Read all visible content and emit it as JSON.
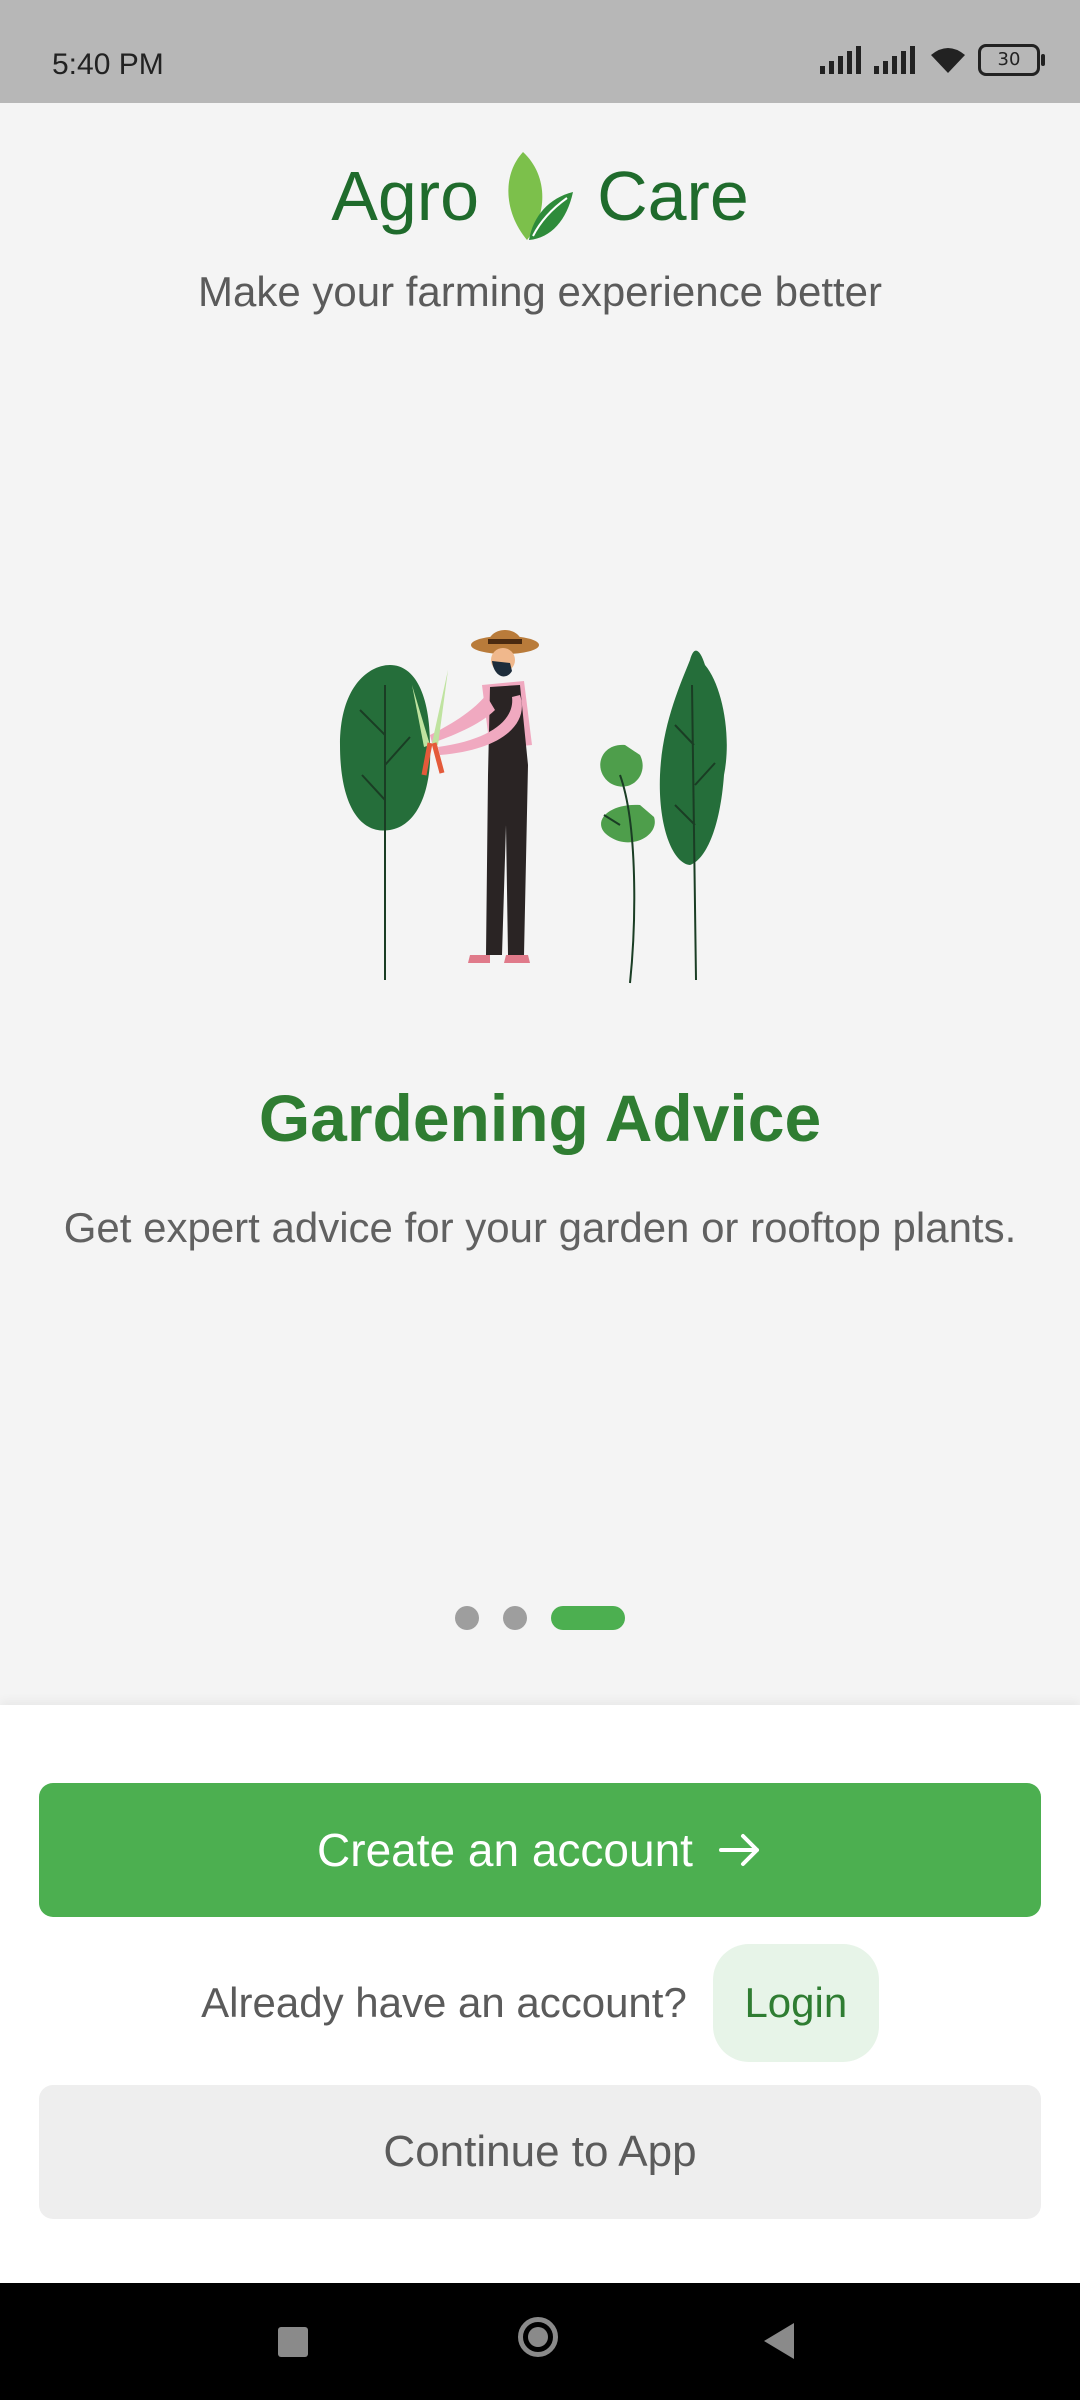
{
  "status_bar": {
    "time": "5:40 PM",
    "battery": "30"
  },
  "brand": {
    "left_word": "Agro",
    "right_word": "Care",
    "tagline": "Make your farming experience better"
  },
  "slide": {
    "title": "Gardening Advice",
    "description": "Get expert advice for your garden or rooftop plants.",
    "current_index": 3,
    "total": 3
  },
  "actions": {
    "create_account": "Create an account",
    "login_prompt": "Already have an account?",
    "login": "Login",
    "continue": "Continue to App"
  },
  "colors": {
    "primary": "#4caf50",
    "title_green": "#2f7d32",
    "brand_green": "#1f6b2c"
  },
  "icons": {
    "arrow": "arrow-right-icon",
    "nav": [
      "square-icon",
      "home-circle-icon",
      "back-triangle-icon"
    ]
  }
}
